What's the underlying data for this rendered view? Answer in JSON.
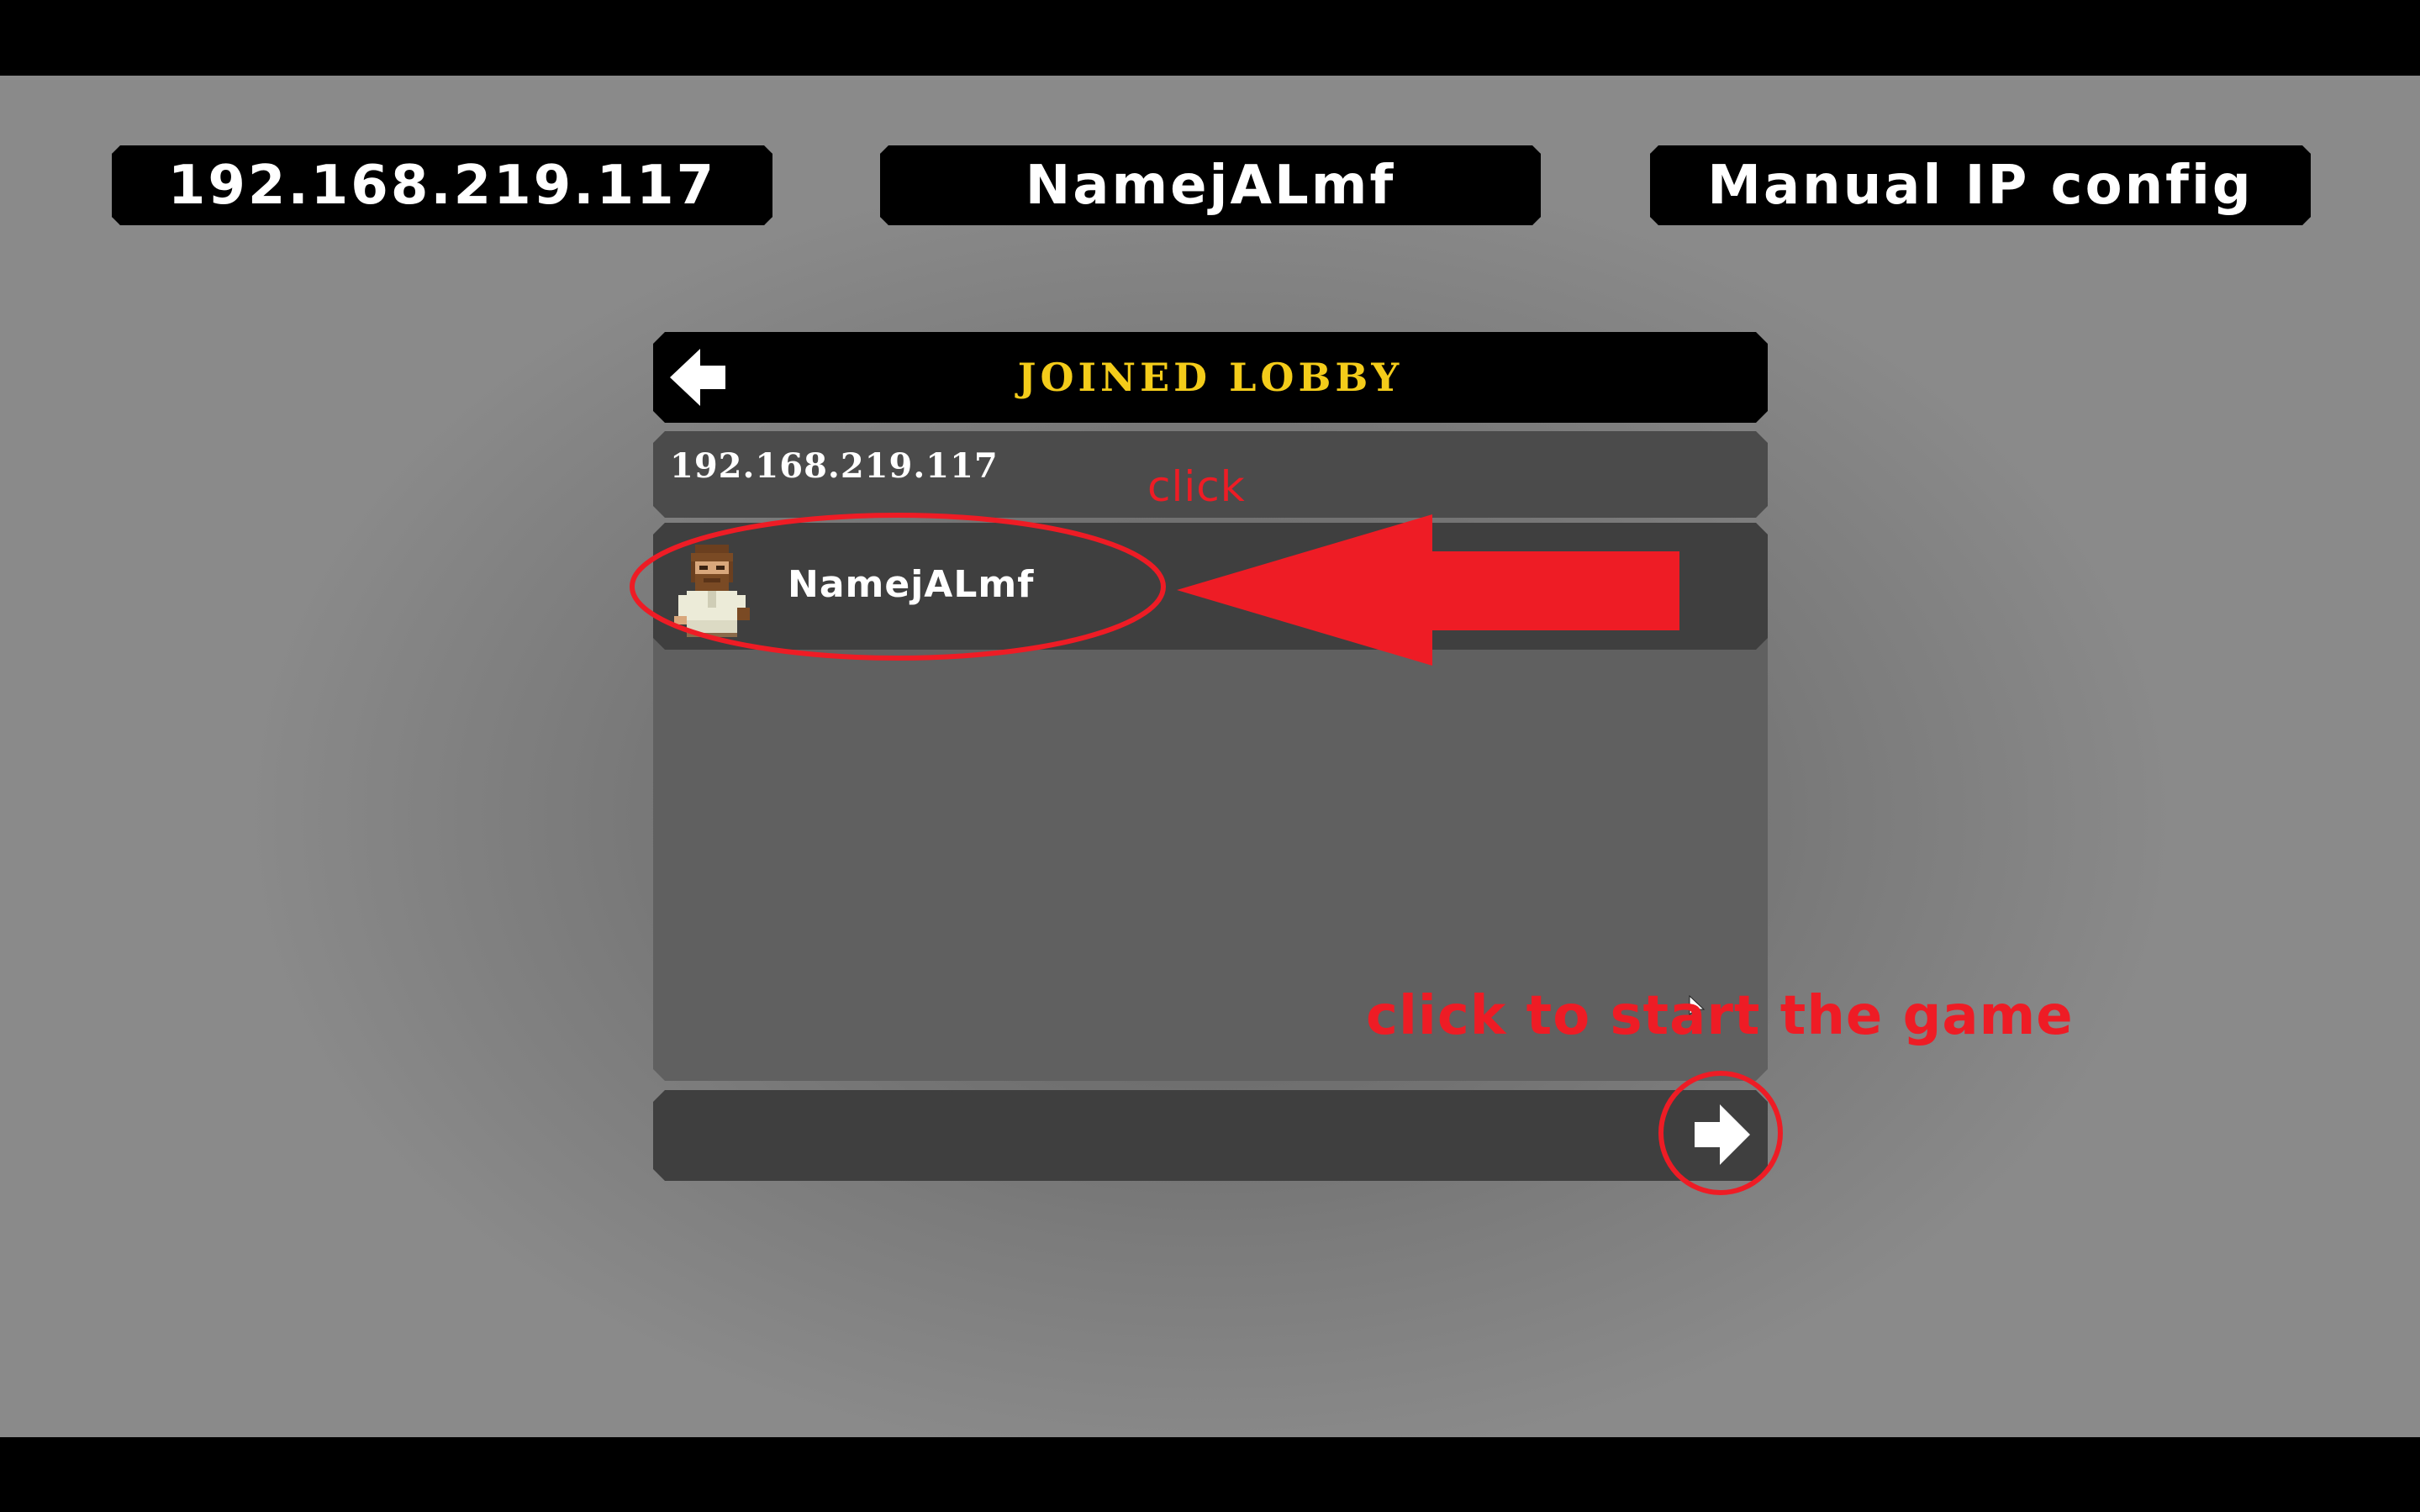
{
  "top_bar": {
    "ip": "192.168.219.117",
    "player_name": "NamejALmf",
    "manual_config": "Manual IP config"
  },
  "lobby": {
    "title": "JOINED LOBBY",
    "back_icon": "arrow-left-icon",
    "host_ip": "192.168.219.117",
    "players": [
      {
        "name": "NamejALmf",
        "avatar": "bearded-character-avatar"
      }
    ],
    "start_icon": "arrow-right-icon"
  },
  "annotations": {
    "click_label": "click",
    "start_label": "click to start the game",
    "color": "#ee1c25"
  },
  "colors": {
    "title_yellow": "#f4cc1a",
    "panel_dark": "#3f3f3f",
    "panel_mid": "#606060",
    "black": "#000000"
  }
}
